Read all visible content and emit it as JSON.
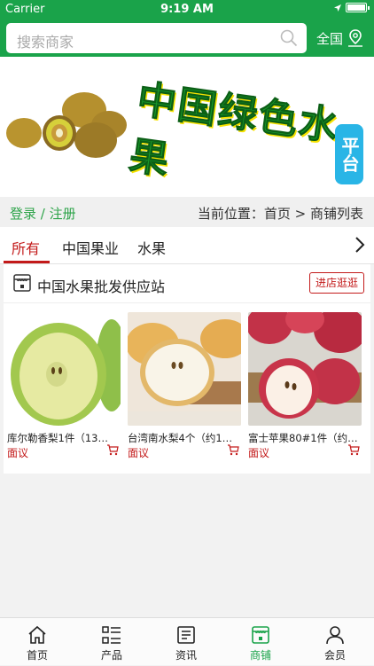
{
  "status": {
    "carrier": "Carrier",
    "time": "9:19 AM"
  },
  "search": {
    "placeholder": "搜索商家",
    "region_label": "全国"
  },
  "banner": {
    "title": "中国绿色水果",
    "tag": "平台"
  },
  "nav": {
    "login_register": "登录 / 注册",
    "breadcrumb": "当前位置：首页 > 商铺列表"
  },
  "tabs": [
    {
      "label": "所有",
      "active": true
    },
    {
      "label": "中国果业",
      "active": false
    },
    {
      "label": "水果",
      "active": false
    }
  ],
  "shop": {
    "name": "中国水果批发供应站",
    "enter_label": "进店逛逛",
    "products": [
      {
        "name": "库尔勒香梨1件（13…",
        "price": "面议",
        "image": "green-pear"
      },
      {
        "name": "台湾南水梨4个（约1…",
        "price": "面议",
        "image": "yellow-pear"
      },
      {
        "name": "富士苹果80#1件（约…",
        "price": "面议",
        "image": "red-apple"
      }
    ]
  },
  "tabbar": [
    {
      "label": "首页",
      "icon": "home-icon",
      "active": false
    },
    {
      "label": "产品",
      "icon": "list-icon",
      "active": false
    },
    {
      "label": "资讯",
      "icon": "news-icon",
      "active": false
    },
    {
      "label": "商铺",
      "icon": "store-icon",
      "active": true
    },
    {
      "label": "会员",
      "icon": "user-icon",
      "active": false
    }
  ],
  "colors": {
    "primary_green": "#1aa34a",
    "accent_red": "#c31a1a",
    "link_green": "#2ea44a"
  }
}
